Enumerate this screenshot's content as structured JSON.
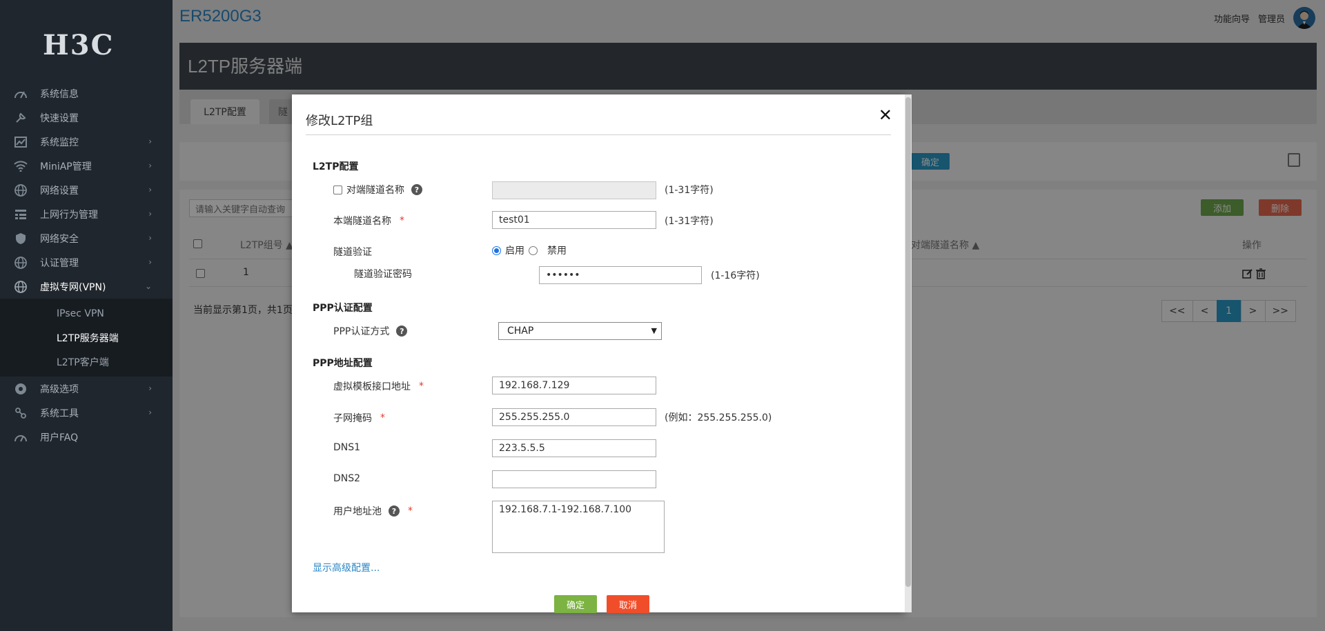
{
  "app": {
    "logo": "H3C",
    "product": "ER5200G3",
    "wizard": "功能向导",
    "user": "管理员"
  },
  "sidebar": {
    "items": [
      {
        "label": "系统信息",
        "icon": "gauge-icon",
        "chevron": ""
      },
      {
        "label": "快速设置",
        "icon": "wrench-icon",
        "chevron": ""
      },
      {
        "label": "系统监控",
        "icon": "monitor-chart-icon",
        "chevron": "›"
      },
      {
        "label": "MiniAP管理",
        "icon": "wifi-icon",
        "chevron": "›"
      },
      {
        "label": "网络设置",
        "icon": "globe-icon",
        "chevron": "›"
      },
      {
        "label": "上网行为管理",
        "icon": "list-icon",
        "chevron": "›"
      },
      {
        "label": "网络安全",
        "icon": "shield-icon",
        "chevron": "›"
      },
      {
        "label": "认证管理",
        "icon": "globe-icon",
        "chevron": "›"
      },
      {
        "label": "虚拟专网(VPN)",
        "icon": "vpn-globe-icon",
        "chevron": "⌄"
      }
    ],
    "sub_items": [
      "IPsec VPN",
      "L2TP服务器端",
      "L2TP客户端"
    ],
    "items_after": [
      {
        "label": "高级选项",
        "icon": "advanced-icon",
        "chevron": "›"
      },
      {
        "label": "系统工具",
        "icon": "tools-icon",
        "chevron": "›"
      },
      {
        "label": "用户FAQ",
        "icon": "faq-icon",
        "chevron": ""
      }
    ]
  },
  "page": {
    "title": "L2TP服务器端",
    "tab_active": "L2TP配置",
    "tab_other": "隧",
    "apply_btn": "确定",
    "search_placeholder": "请输入关键字自动查询",
    "add_btn": "添加",
    "delete_btn": "删除",
    "col_group": "L2TP组号 ▲",
    "col_remote": "对端隧道名称 ▲",
    "col_ops": "操作",
    "row_group": "1",
    "page_info": "当前显示第1页，共1页",
    "pager": [
      "<<",
      "<",
      "1",
      ">",
      ">>"
    ]
  },
  "modal": {
    "title": "修改L2TP组",
    "close": "✕",
    "sec_l2tp": "L2TP配置",
    "remote_tunnel_label": "对端隧道名称",
    "remote_tunnel_value": "",
    "remote_tunnel_hint": "(1-31字符)",
    "local_tunnel_label": "本端隧道名称",
    "local_tunnel_value": "test01",
    "local_tunnel_hint": "(1-31字符)",
    "tunnel_auth_label": "隧道验证",
    "enable_label": "启用",
    "disable_label": "禁用",
    "tunnel_pwd_label": "隧道验证密码",
    "tunnel_pwd_value": "••••••",
    "tunnel_pwd_hint": "(1-16字符)",
    "sec_ppp_auth": "PPP认证配置",
    "ppp_auth_label": "PPP认证方式",
    "ppp_auth_value": "CHAP",
    "sec_ppp_addr": "PPP地址配置",
    "vt_ip_label": "虚拟模板接口地址",
    "vt_ip_value": "192.168.7.129",
    "mask_label": "子网掩码",
    "mask_value": "255.255.255.0",
    "mask_hint": "(例如：255.255.255.0)",
    "dns1_label": "DNS1",
    "dns1_value": "223.5.5.5",
    "dns2_label": "DNS2",
    "dns2_value": "",
    "pool_label": "用户地址池",
    "pool_value": "192.168.7.1-192.168.7.100",
    "advanced_link": "显示高级配置...",
    "ok_btn": "确定",
    "cancel_btn": "取消"
  },
  "colors": {
    "sidebar_bg": "#20262d",
    "accent_blue": "#2b87c7",
    "ok_green": "#7cb342",
    "cancel_red": "#f04e2b",
    "add_green": "#6ea84d",
    "delete_red": "#e8694f"
  }
}
